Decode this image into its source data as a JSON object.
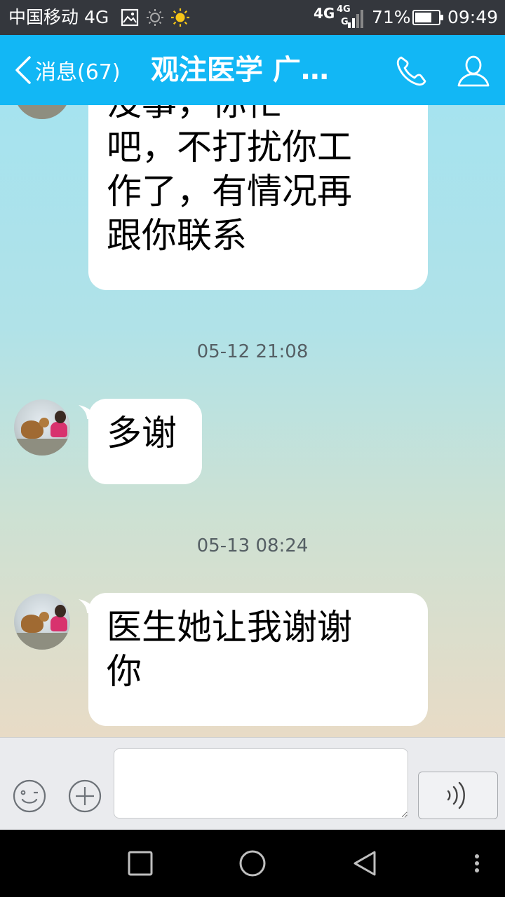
{
  "status_bar": {
    "carrier": "中国移动 4G",
    "network_1": "4G",
    "network_2": "4G",
    "network_3": "G",
    "battery": "71%",
    "battery_level": 0.71,
    "time": "09:49",
    "icons": [
      "image-icon",
      "brightness-icon",
      "sun-icon",
      "signal-icon",
      "battery-icon"
    ]
  },
  "header": {
    "back_label": "消息(67)",
    "title": "观注医学 广…",
    "icons": [
      "back-chevron-icon",
      "phone-icon",
      "profile-icon"
    ]
  },
  "colors": {
    "header_bg": "#12b7f5",
    "status_bg": "#34373d",
    "bubble_bg": "#ffffff"
  },
  "messages": [
    {
      "text": "没事，你忙\n吧，不打扰你工\n作了，有情况再\n跟你联系"
    },
    {
      "text": "多谢"
    },
    {
      "text": "医生她让我谢谢\n你"
    }
  ],
  "timestamps": [
    "05-12 21:08",
    "05-13 08:24"
  ],
  "input_bar": {
    "placeholder": "",
    "icons": [
      "emoji-icon",
      "plus-icon",
      "voice-icon"
    ]
  },
  "nav_bar": {
    "icons": [
      "recent-apps-icon",
      "home-icon",
      "back-icon",
      "menu-icon"
    ]
  }
}
